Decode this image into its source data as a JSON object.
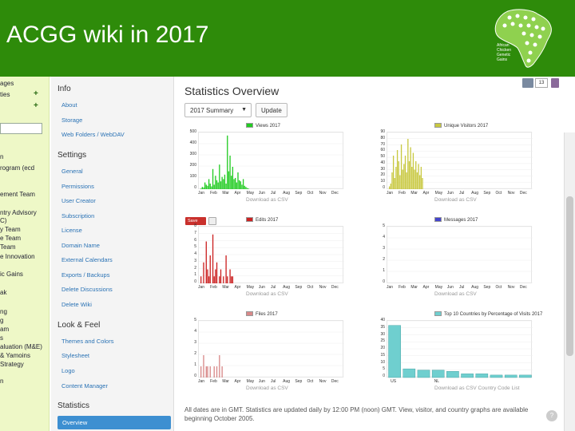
{
  "slide": {
    "title": "ACGG wiki in 2017"
  },
  "logo": {
    "text": "African Chicken Genetic Gains"
  },
  "top_icons": {
    "count": "13"
  },
  "leftbar": {
    "items": [
      "ages",
      "ties",
      "n",
      "rogram (ecd",
      "ement Team",
      "ntry Advisory",
      "C)",
      "y Team",
      "e Team",
      "Team",
      "e Innovation",
      "ic Gains",
      "ak",
      "ng",
      "g",
      "am",
      "s",
      "aluation (M&E)",
      "& Yamoins",
      "Strategy",
      "n"
    ]
  },
  "nav": {
    "sections": [
      {
        "heading": "Info",
        "links": [
          "About",
          "Storage",
          "Web Folders / WebDAV"
        ]
      },
      {
        "heading": "Settings",
        "links": [
          "General",
          "Permissions",
          "User Creator",
          "Subscription",
          "License",
          "Domain Name",
          "External Calendars",
          "Exports / Backups",
          "Delete Discussions",
          "Delete Wiki"
        ]
      },
      {
        "heading": "Look & Feel",
        "links": [
          "Themes and Colors",
          "Stylesheet",
          "Logo",
          "Content Manager"
        ]
      },
      {
        "heading": "Statistics",
        "links": []
      }
    ],
    "active": "Overview"
  },
  "main": {
    "title": "Statistics Overview",
    "period_select": "2017 Summary",
    "update_label": "Update",
    "save_label": "Save",
    "footer": "All dates are in GMT. Statistics are updated daily by 12:00 PM (noon) GMT. View, visitor, and country graphs are available beginning October 2005."
  },
  "months": [
    "Jan",
    "Feb",
    "Mar",
    "Apr",
    "May",
    "Jun",
    "Jul",
    "Aug",
    "Sep",
    "Oct",
    "Nov",
    "Dec"
  ],
  "chart_data": [
    {
      "type": "bar",
      "title": "Views 2017",
      "color": "#22cc22",
      "ylim": [
        0,
        500
      ],
      "yticks": [
        "500",
        "400",
        "300",
        "200",
        "100",
        "0"
      ],
      "values": [
        5,
        20,
        15,
        60,
        40,
        30,
        90,
        50,
        25,
        180,
        40,
        120,
        80,
        60,
        220,
        70,
        110,
        90,
        130,
        50,
        480,
        160,
        300,
        120,
        200,
        90,
        100,
        60,
        150,
        80,
        70,
        40,
        90,
        30,
        20,
        10,
        5
      ],
      "download": "Download as CSV"
    },
    {
      "type": "bar",
      "title": "Unique Visitors 2017",
      "color": "#c8c840",
      "ylim": [
        0,
        100
      ],
      "yticks": [
        "90",
        "80",
        "70",
        "60",
        "50",
        "40",
        "30",
        "20",
        "10",
        "0"
      ],
      "values": [
        5,
        10,
        30,
        60,
        20,
        40,
        70,
        50,
        25,
        80,
        35,
        45,
        60,
        30,
        90,
        50,
        75,
        40,
        65,
        35,
        50,
        30,
        45,
        25,
        40,
        20
      ],
      "download": "Download as CSV"
    },
    {
      "type": "bar",
      "title": "Edits 2017",
      "color": "#cc2222",
      "ylim": [
        0,
        8
      ],
      "yticks": [
        "8",
        "7",
        "6",
        "5",
        "4",
        "3",
        "2",
        "1",
        "0"
      ],
      "values": [
        1,
        0,
        3,
        0,
        6,
        2,
        1,
        4,
        0,
        7,
        1,
        2,
        3,
        0,
        1,
        2,
        0,
        1,
        0,
        4,
        1,
        0,
        2,
        1,
        1
      ],
      "download": "Download as CSV"
    },
    {
      "type": "bar",
      "title": "Messages 2017",
      "color": "#4444cc",
      "ylim": [
        0,
        5
      ],
      "yticks": [
        "5",
        "4",
        "3",
        "2",
        "1",
        "0"
      ],
      "values": [],
      "download": "Download as CSV"
    },
    {
      "type": "bar",
      "title": "Files 2017",
      "color": "#d88888",
      "ylim": [
        0,
        5
      ],
      "yticks": [
        "5",
        "4",
        "3",
        "2",
        "1",
        "0"
      ],
      "values": [
        1,
        0,
        2,
        0,
        1,
        1,
        0,
        1,
        0,
        0,
        1,
        0,
        1,
        0,
        2,
        0,
        1
      ],
      "download": "Download as CSV"
    },
    {
      "type": "bar",
      "title": "Top 10 Countries by Percentage of Visits 2017",
      "color": "#6fcfcf",
      "ylim": [
        0,
        45
      ],
      "yticks": [
        "40",
        "35",
        "30",
        "25",
        "20",
        "15",
        "10",
        "5",
        "0"
      ],
      "categories": [
        "US",
        "",
        "",
        "NL",
        "",
        "",
        "",
        "",
        "",
        ""
      ],
      "values": [
        42,
        7,
        6,
        6,
        5,
        3,
        3,
        2,
        2,
        2
      ],
      "download": "Download as CSV",
      "extra": "Country Code List"
    }
  ]
}
